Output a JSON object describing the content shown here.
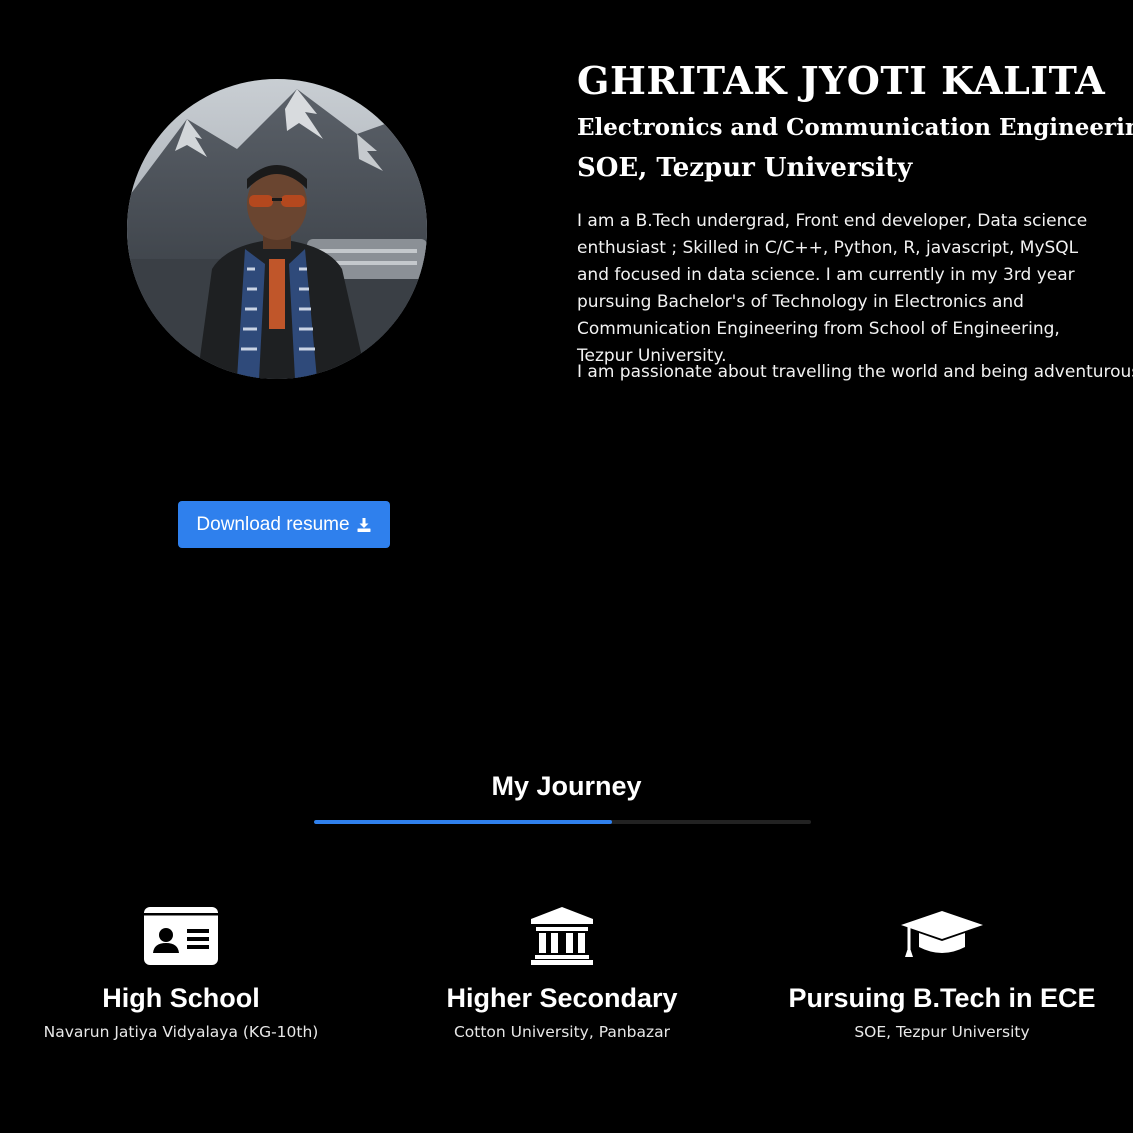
{
  "profile": {
    "name": "GHRITAK JYOTI KALITA",
    "department": "Electronics and Communication Engineering",
    "school": "SOE, Tezpur University",
    "bio": "I am a B.Tech undergrad, Front end developer, Data science enthusiast ; Skilled in C/C++, Python, R, javascript, MySQL and focused in data science. I am currently in my 3rd year pursuing Bachelor's of Technology in Electronics and Communication Engineering from School of Engineering, Tezpur University.",
    "bio_extra": "I am passionate about travelling the world and being adventurous.",
    "photo_icon": "profile-photo"
  },
  "actions": {
    "download_resume_label": "Download resume",
    "download_icon": "download-icon"
  },
  "journey": {
    "title": "My Journey",
    "progress": 0.6,
    "accent_color": "#2f80ed",
    "milestones": [
      {
        "icon": "id-card-icon",
        "title": "High School",
        "subtitle": "Navarun Jatiya Vidyalaya (KG-10th)"
      },
      {
        "icon": "university-building-icon",
        "title": "Higher Secondary",
        "subtitle": "Cotton University, Panbazar"
      },
      {
        "icon": "graduation-cap-icon",
        "title": "Pursuing B.Tech in ECE",
        "subtitle": "SOE, Tezpur University"
      }
    ]
  }
}
